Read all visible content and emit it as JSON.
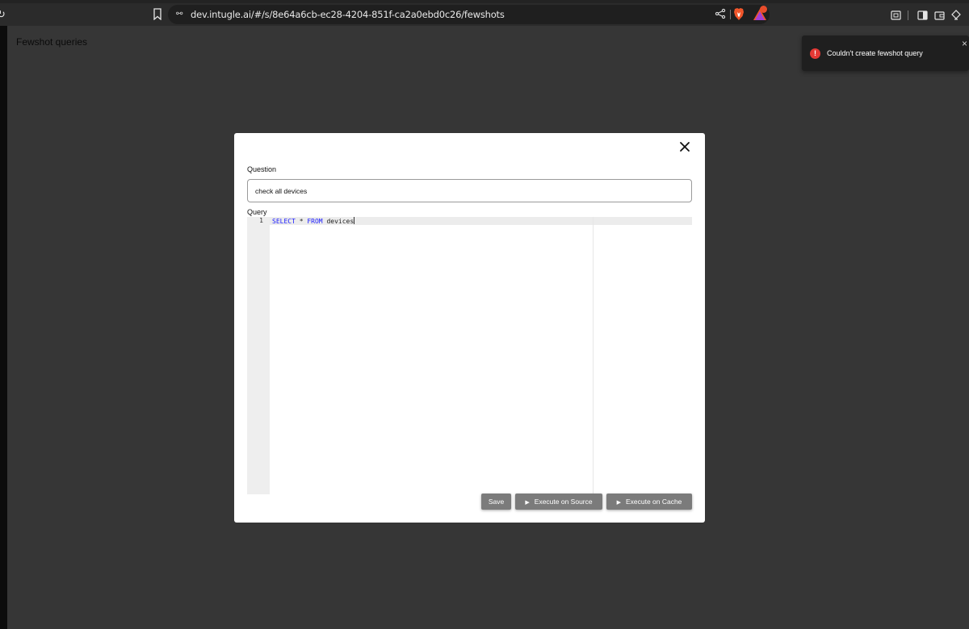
{
  "browser": {
    "url": "dev.intugle.ai/#/s/8e64a6cb-ec28-4204-851f-ca2a0ebd0c26/fewshots",
    "icons": [
      "reload-icon",
      "bookmark-icon",
      "site-settings-icon",
      "share-icon",
      "brave-shields-icon",
      "brave-rewards-icon",
      "screenshot-icon",
      "sidebar-icon",
      "wallet-icon",
      "extensions-icon"
    ]
  },
  "page": {
    "title": "Fewshot queries"
  },
  "toast": {
    "message": "Couldn't create fewshot query",
    "icon": "!",
    "close": "×",
    "color": "#e53935"
  },
  "modal": {
    "question_label": "Question",
    "question_value": "check all devices",
    "query_label": "Query",
    "editor": {
      "line_number": "1",
      "keyword_select": "SELECT",
      "star": " * ",
      "keyword_from": "FROM",
      "table": " devices"
    },
    "buttons": {
      "save": "Save",
      "execute_source": "Execute on Source",
      "execute_cache": "Execute on Cache"
    }
  },
  "colors": {
    "background": "#363636",
    "modal": "#ffffff",
    "button": "#7b7b7b",
    "keyword": "#1a1aff"
  }
}
